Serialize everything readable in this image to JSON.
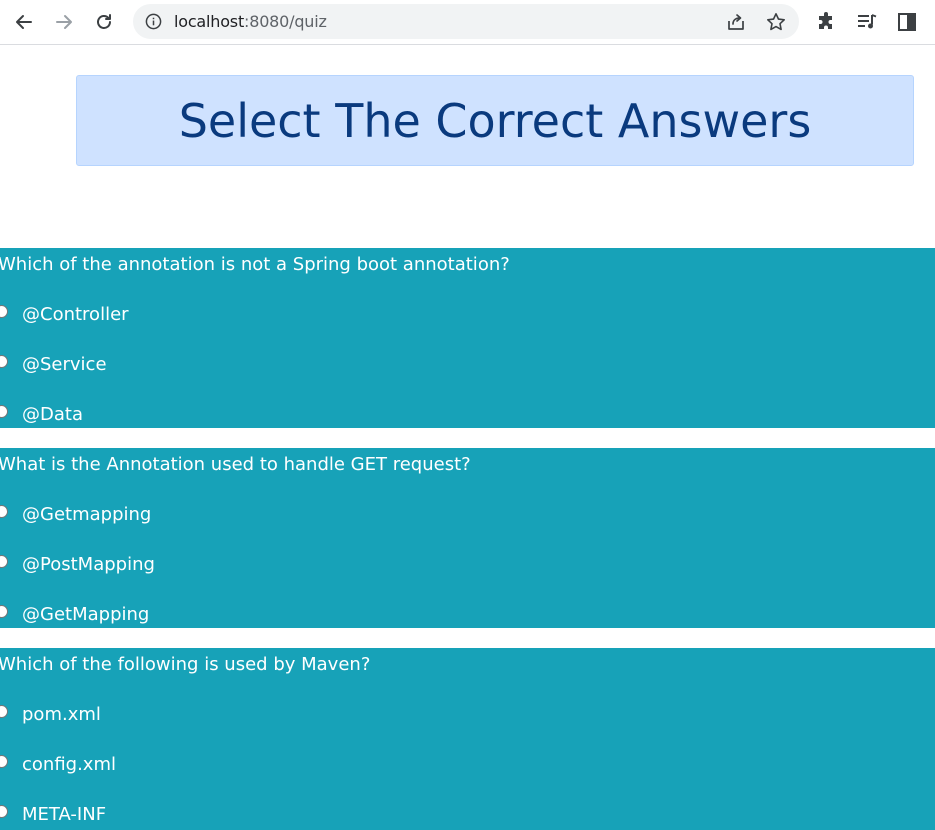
{
  "browser": {
    "url_host": "localhost",
    "url_path": ":8080/quiz"
  },
  "page": {
    "title": "Select The Correct Answers"
  },
  "questions": [
    {
      "text": "Which of the annotation is not a Spring boot annotation?",
      "options": [
        "@Controller",
        "@Service",
        "@Data"
      ]
    },
    {
      "text": "What is the Annotation used to handle GET request?",
      "options": [
        "@Getmapping",
        "@PostMapping",
        "@GetMapping"
      ]
    },
    {
      "text": "Which of the following is used by Maven?",
      "options": [
        "pom.xml",
        "config.xml",
        "META-INF"
      ]
    }
  ],
  "colors": {
    "question_bg": "#17a2b8",
    "header_bg": "#cfe2ff",
    "header_text": "#0a3a7e"
  }
}
